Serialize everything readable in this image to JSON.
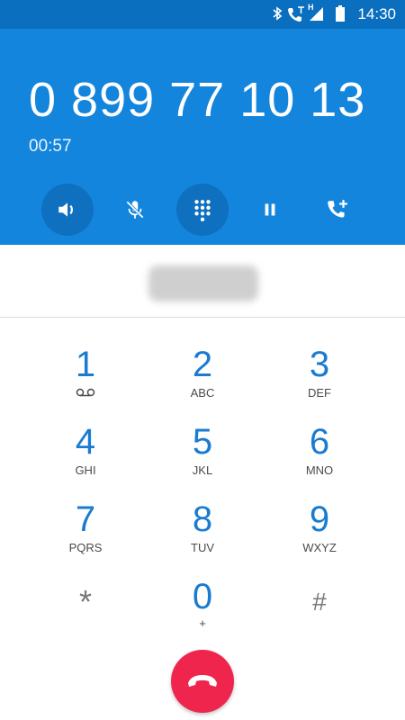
{
  "status_bar": {
    "time": "14:30",
    "network_type": "H",
    "icons": [
      "bluetooth-icon",
      "call-icon",
      "signal-icon",
      "battery-icon"
    ]
  },
  "call": {
    "number": "0 899 77 10 13",
    "duration": "00:57"
  },
  "controls": [
    {
      "name": "speaker",
      "icon": "speaker-icon",
      "active": true
    },
    {
      "name": "mute",
      "icon": "mic-off-icon",
      "active": false
    },
    {
      "name": "dialpad",
      "icon": "dialpad-icon",
      "active": true
    },
    {
      "name": "hold",
      "icon": "pause-icon",
      "active": false
    },
    {
      "name": "add-call",
      "icon": "add-call-icon",
      "active": false
    }
  ],
  "dialpad": {
    "keys": [
      {
        "digit": "1",
        "letters": ""
      },
      {
        "digit": "2",
        "letters": "ABC"
      },
      {
        "digit": "3",
        "letters": "DEF"
      },
      {
        "digit": "4",
        "letters": "GHI"
      },
      {
        "digit": "5",
        "letters": "JKL"
      },
      {
        "digit": "6",
        "letters": "MNO"
      },
      {
        "digit": "7",
        "letters": "PQRS"
      },
      {
        "digit": "8",
        "letters": "TUV"
      },
      {
        "digit": "9",
        "letters": "WXYZ"
      },
      {
        "digit": "*",
        "letters": ""
      },
      {
        "digit": "0",
        "letters": "+"
      },
      {
        "digit": "#",
        "letters": ""
      }
    ]
  },
  "colors": {
    "status_bar": "#0b6fbf",
    "header": "#1385dd",
    "active_control": "#0f70c0",
    "digit": "#1a7bd0",
    "end_call": "#f0254e"
  }
}
